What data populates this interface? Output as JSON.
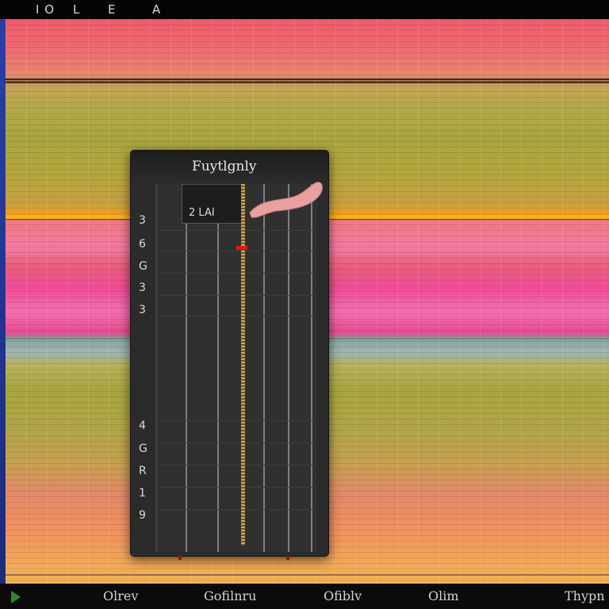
{
  "menu": [
    "I O",
    "L",
    "E",
    "A"
  ],
  "panel": {
    "title": "Fuytlgnly",
    "value": "2 LAI",
    "row_numbers_top": [
      "3",
      "6",
      "G",
      "3",
      "3"
    ],
    "row_numbers_bottom": [
      "4",
      "G",
      "R",
      "1",
      "9"
    ]
  },
  "footer": {
    "labels": [
      "Olrev",
      "Gofilnru",
      "Ofiblv",
      "Olim",
      "Thypn"
    ]
  },
  "icons": [
    "play-icon",
    "drag-handle-icon"
  ],
  "colors": {
    "playhead": "#e01818",
    "play": "#2c8a2c",
    "accent_stripe": "#f5b31a"
  }
}
